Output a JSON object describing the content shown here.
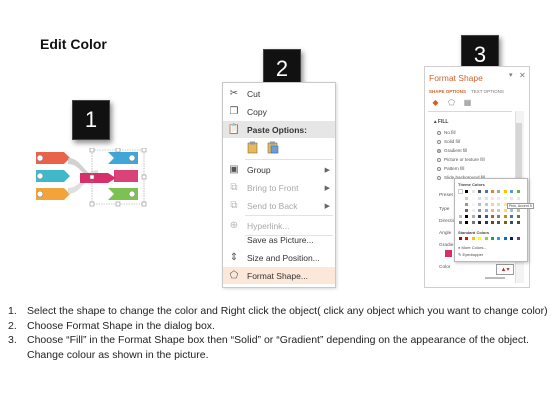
{
  "title": "Edit Color",
  "steps": {
    "one": "1",
    "two": "2",
    "three": "3"
  },
  "context_menu": {
    "cut": "Cut",
    "copy": "Copy",
    "paste_options": "Paste Options:",
    "group": "Group",
    "bring_to_front": "Bring to Front",
    "send_to_back": "Send to Back",
    "hyperlink": "Hyperlink...",
    "save_as_picture": "Save as Picture...",
    "size_and_position": "Size and Position...",
    "format_shape": "Format Shape..."
  },
  "format_pane": {
    "title": "Format Shape",
    "tab_shape_options": "SHAPE OPTIONS",
    "tab_text_options": "TEXT OPTIONS",
    "fill_heading": "FILL",
    "fill_options": [
      {
        "label": "No fill",
        "selected": false
      },
      {
        "label": "Solid fill",
        "selected": false
      },
      {
        "label": "Gradient fill",
        "selected": true
      },
      {
        "label": "Picture or texture fill",
        "selected": false
      },
      {
        "label": "Pattern fill",
        "selected": false
      },
      {
        "label": "Slide background fill",
        "selected": false
      }
    ],
    "prop_labels": [
      "Preset",
      "Type",
      "Directio",
      "Angle",
      "Gradie",
      "Color"
    ],
    "color_popup": {
      "theme_colors": "Theme Colors",
      "tooltip": "Pink, Accent 5",
      "standard_colors": "Standard Colors",
      "more_colors": "More Colors...",
      "eyedropper": "Eyedropper"
    }
  },
  "colors": {
    "accent": "#d0622a",
    "highlight": "#fbe8d8",
    "theme_top": [
      "#ffffff",
      "#000000",
      "#e7e6e6",
      "#44546a",
      "#4472c4",
      "#ed7d31",
      "#a5a5a5",
      "#ffc000",
      "#5b9bd5",
      "#70ad47"
    ],
    "standard": [
      "#c00000",
      "#ff0000",
      "#ffc000",
      "#ffff00",
      "#92d050",
      "#00b050",
      "#00b0f0",
      "#0070c0",
      "#002060",
      "#7030a0"
    ],
    "graphic_left": [
      "#e8634a",
      "#3fb8c9",
      "#f2a33a"
    ],
    "graphic_right": [
      "#3fa7d6",
      "#d62f6a",
      "#7cc152"
    ]
  },
  "instructions": [
    {
      "num": "1.",
      "text": "Select the shape to change the color and Right click the object( click any object which you want to change color)"
    },
    {
      "num": "2.",
      "text": "Choose Format Shape in the dialog box."
    },
    {
      "num": "3.",
      "text": "Choose “Fill” in the Format Shape box then “Solid” or “Gradient” depending on the appearance of the object. Change colour as shown in the picture."
    }
  ]
}
